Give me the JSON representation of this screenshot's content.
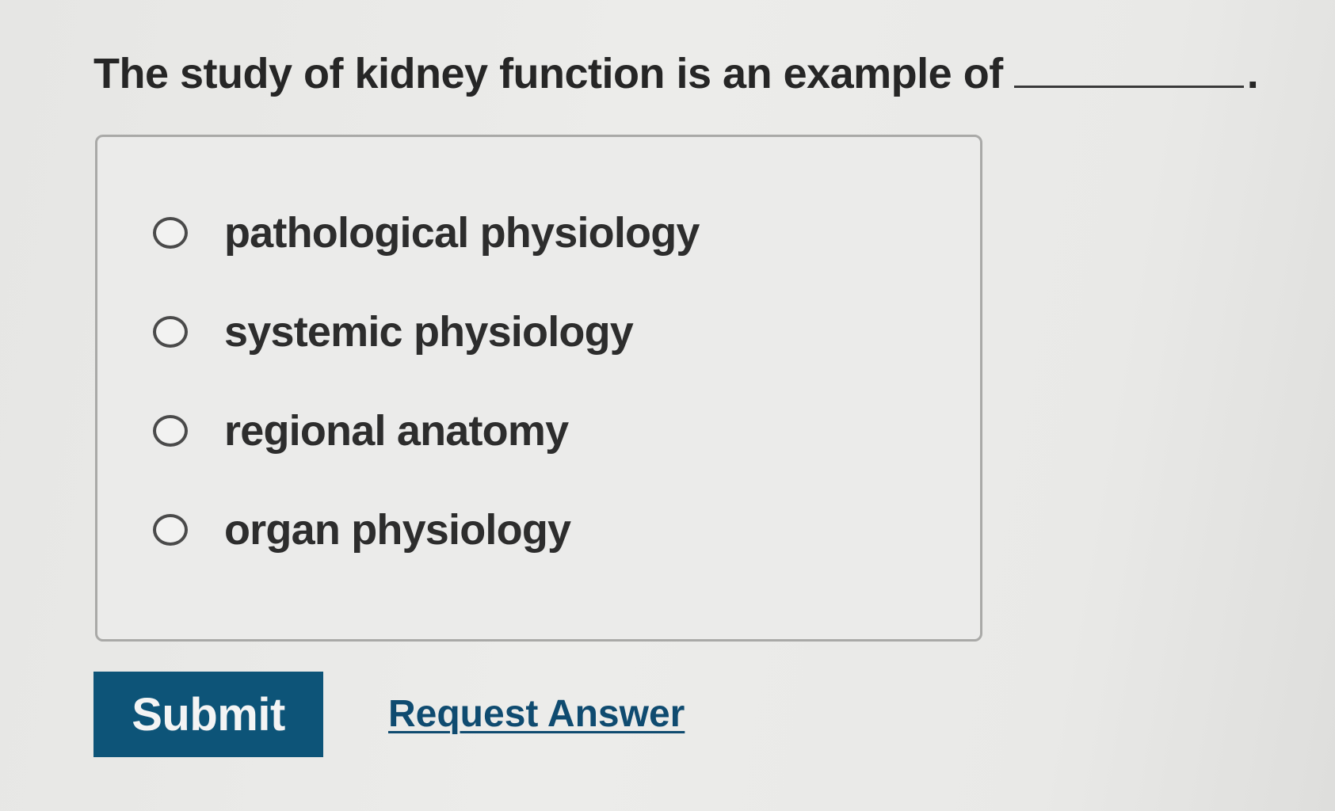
{
  "question": {
    "text": "The study of kidney function is an example of",
    "end_mark": "."
  },
  "options": [
    {
      "label": "pathological physiology",
      "selected": false
    },
    {
      "label": "systemic physiology",
      "selected": false
    },
    {
      "label": "regional anatomy",
      "selected": false
    },
    {
      "label": "organ physiology",
      "selected": false
    }
  ],
  "actions": {
    "submit_label": "Submit",
    "request_answer_label": "Request Answer"
  },
  "colors": {
    "submit_background": "#0d5478",
    "link": "#0f4b70"
  }
}
